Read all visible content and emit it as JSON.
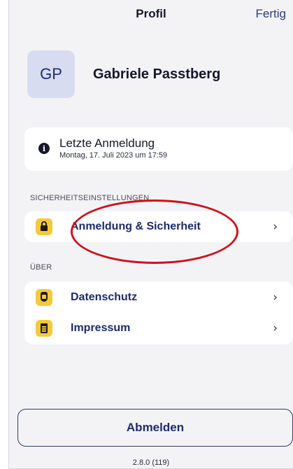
{
  "header": {
    "title": "Profil",
    "done_label": "Fertig"
  },
  "profile": {
    "initials": "GP",
    "name": "Gabriele Passtberg"
  },
  "last_login": {
    "title": "Letzte Anmeldung",
    "date": "Montag, 17. Juli 2023 um 17:59",
    "icon": "info-icon"
  },
  "sections": {
    "security": {
      "header": "SICHERHEITSEINSTELLUNGEN",
      "items": [
        {
          "label": "Anmeldung & Sicherheit",
          "icon": "lock-icon"
        }
      ]
    },
    "about": {
      "header": "ÜBER",
      "items": [
        {
          "label": "Datenschutz",
          "icon": "shield-icon"
        },
        {
          "label": "Impressum",
          "icon": "document-icon"
        }
      ]
    }
  },
  "chevron": "›",
  "logout_label": "Abmelden",
  "version": "2.8.0 (119)",
  "colors": {
    "accent": "#1d2b6e",
    "icon_bg": "#f5c93a",
    "background": "#f3f3f6",
    "annotation": "#d0101a"
  }
}
